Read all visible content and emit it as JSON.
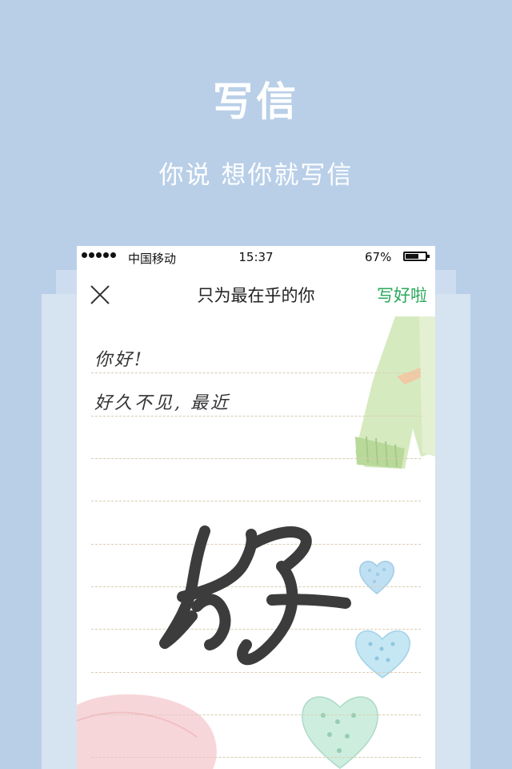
{
  "promo": {
    "title": "写信",
    "subtitle": "你说  想你就写信"
  },
  "status_bar": {
    "carrier": "中国移动",
    "time": "15:37",
    "battery_percent": "67%",
    "battery_level": 0.67
  },
  "nav": {
    "title": "只为最在乎的你",
    "done_label": "写好啦",
    "close_icon": "close-icon"
  },
  "letter": {
    "lines": [
      "你好!",
      "好久不见, 最近"
    ]
  },
  "handwriting_glyph": "好",
  "colors": {
    "background": "#b9cfe8",
    "accent_green": "#2aa85a",
    "ink": "#3a3a3a",
    "rule": "#d9cdb2"
  }
}
